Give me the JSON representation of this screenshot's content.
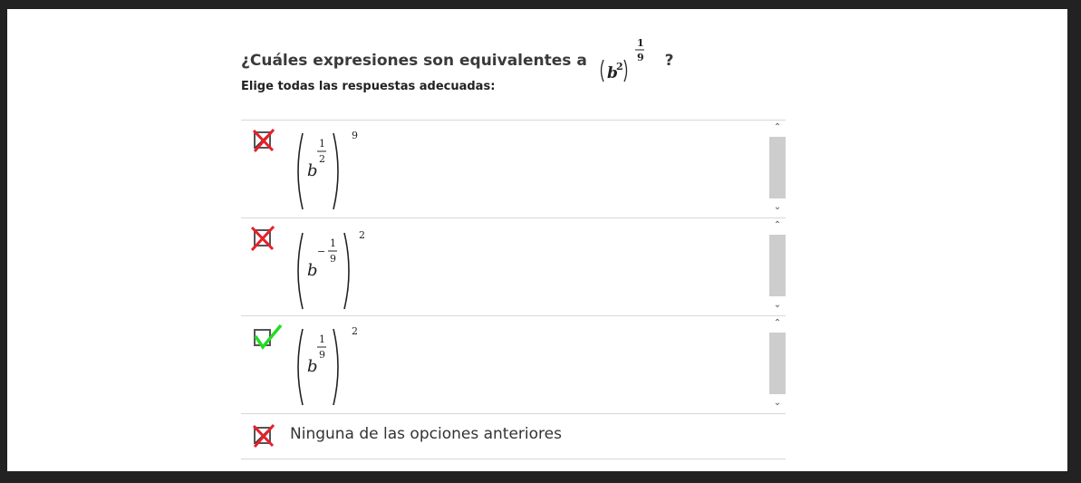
{
  "question": {
    "prefix": "¿Cuáles expresiones son equivalentes a",
    "base": "b",
    "inner_exp": "2",
    "outer_num": "1",
    "outer_den": "9",
    "suffix": "?"
  },
  "instruction": "Elige todas las respuestas adecuadas:",
  "options": [
    {
      "base": "b",
      "exp_num": "1",
      "exp_den": "2",
      "outer_exp": "9",
      "checked": true,
      "mark": "incorrect"
    },
    {
      "base": "b",
      "exp_sign": "−",
      "exp_num": "1",
      "exp_den": "9",
      "outer_exp": "2",
      "checked": true,
      "mark": "incorrect"
    },
    {
      "base": "b",
      "exp_num": "1",
      "exp_den": "9",
      "outer_exp": "2",
      "checked": false,
      "mark": "correct"
    },
    {
      "label": "Ninguna de las opciones anteriores",
      "checked": true,
      "mark": "incorrect"
    }
  ],
  "colors": {
    "incorrect_mark": "#e8202a",
    "correct_mark": "#22dd22"
  },
  "icons": {
    "scroll_up": "chevron-up-icon",
    "scroll_down": "chevron-down-icon"
  }
}
